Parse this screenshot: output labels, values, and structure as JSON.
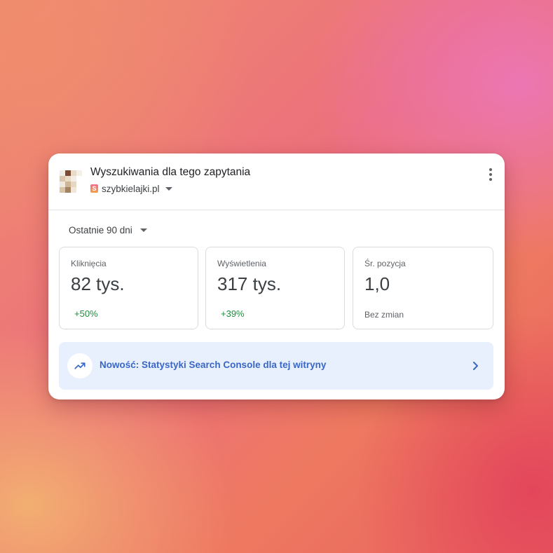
{
  "header": {
    "title": "Wyszukiwania dla tego zapytania",
    "site_icon_glyph": "S",
    "site_name": "szybkielajki.pl",
    "favicon_colors": [
      "#f1ece6",
      "#7a4a34",
      "#e8dcc9",
      "#f4efe8",
      "#d9c7ad",
      "#e9dcc6",
      "#f3ede6",
      "#ffffff",
      "#efe8dd",
      "#cdb595",
      "#e6d7c2",
      "#ffffff",
      "#d8c3a6",
      "#a48363",
      "#f0e7da",
      "#ffffff"
    ]
  },
  "period": {
    "label": "Ostatnie 90 dni"
  },
  "metrics": [
    {
      "label": "Kliknięcia",
      "value": "82 tys.",
      "change": "+50%"
    },
    {
      "label": "Wyświetlenia",
      "value": "317 tys.",
      "change": "+39%"
    },
    {
      "label": "Śr. pozycja",
      "value": "1,0",
      "change": "Bez zmian"
    }
  ],
  "promo": {
    "text": "Nowość: Statystyki Search Console dla tej witryny"
  },
  "colors": {
    "accent_blue": "#3a67c6",
    "promo_bg": "#e8f0fe",
    "positive_green": "#1e8e3e"
  },
  "icons": {
    "menu": "more-vert-icon",
    "trend": "trending-up-icon",
    "chevron": "chevron-right-icon"
  }
}
